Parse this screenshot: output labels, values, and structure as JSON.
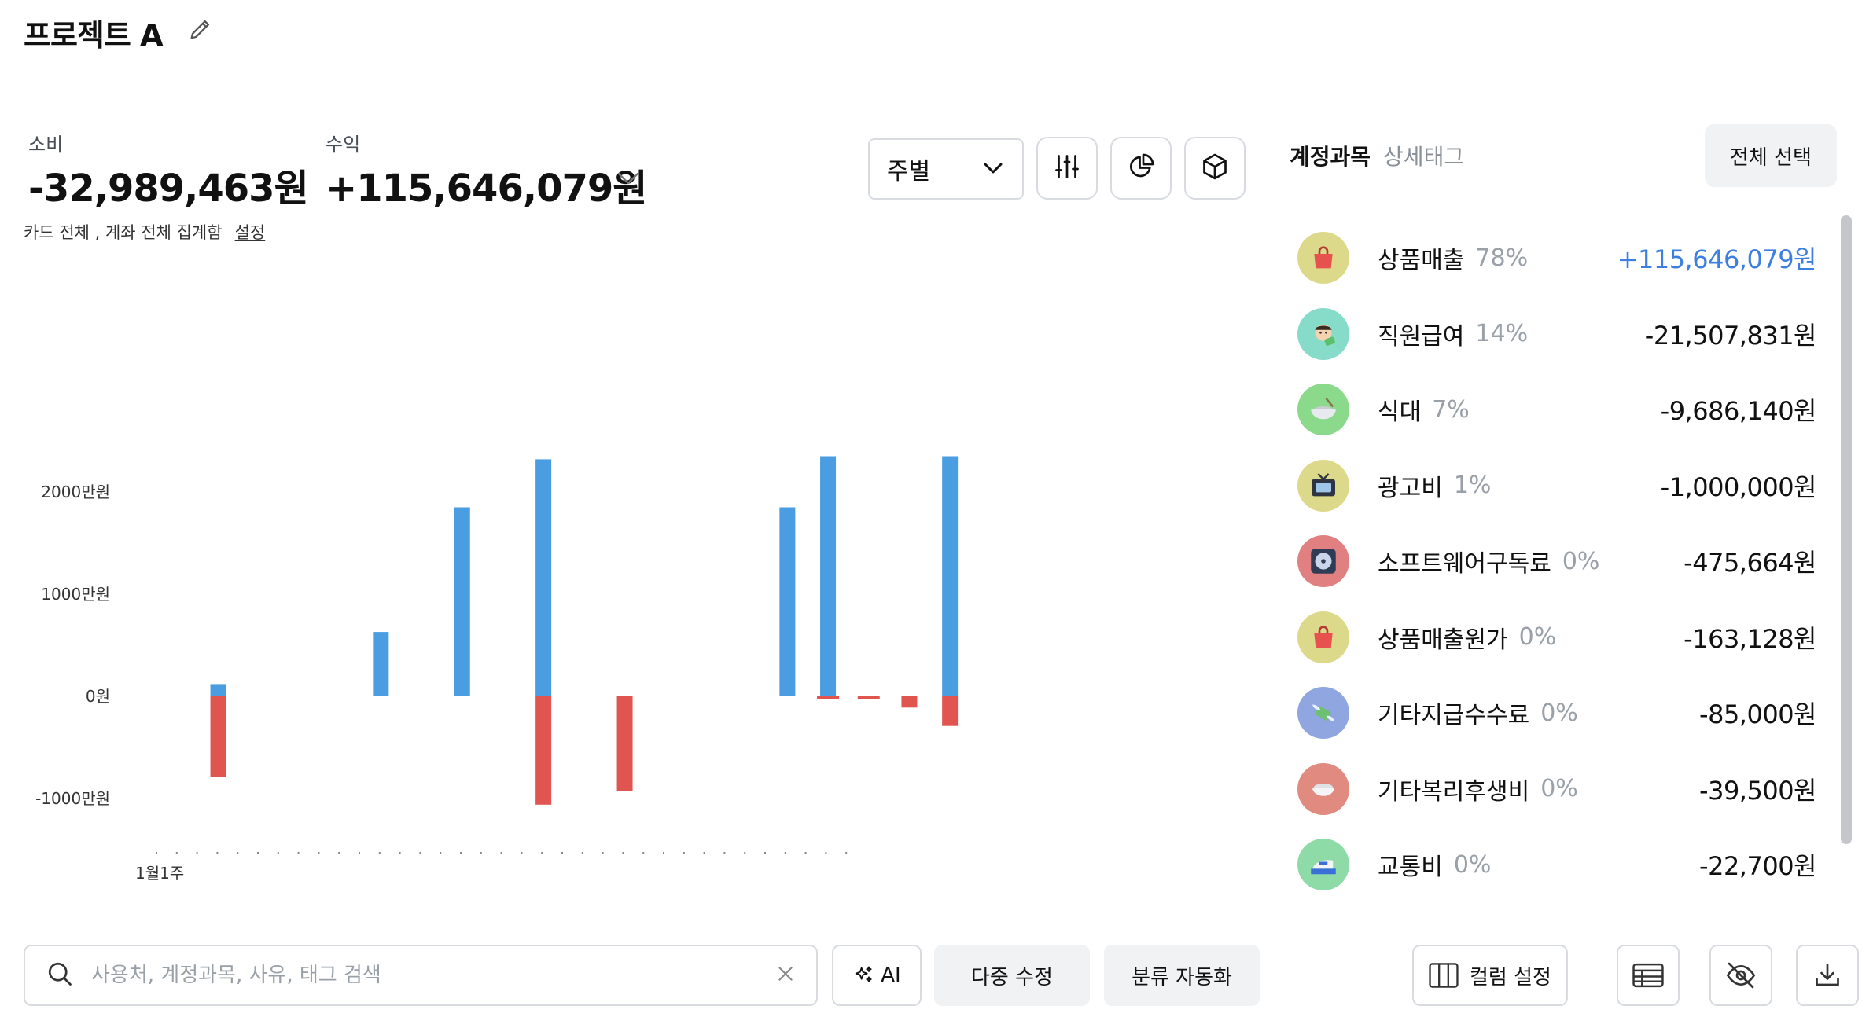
{
  "header": {
    "title": "프로젝트 A"
  },
  "summary": {
    "expense_label": "소비",
    "expense_value": "-32,989,463원",
    "income_label": "수익",
    "income_value": "+115,646,079원",
    "agg_note": "카드 전체 , 계좌 전체 집계함",
    "agg_link": "설정"
  },
  "controls": {
    "period_value": "주별"
  },
  "chart_data": {
    "type": "bar",
    "x_start_label": "1월1주",
    "y_tick_labels": [
      "2000만원",
      "1000만원",
      "0원",
      "-1000만원"
    ],
    "y_ticks": [
      20000000,
      10000000,
      0,
      -10000000
    ],
    "ylim": [
      -10500000,
      23500000
    ],
    "slots": 26,
    "series": [
      {
        "color": "#4a9de0",
        "values": [
          1200000,
          0,
          6300000,
          18500000,
          23200000,
          0,
          0,
          18500000,
          23500000,
          0,
          0,
          23500000
        ]
      },
      {
        "color": "#e05550",
        "values": [
          -7900000,
          0,
          0,
          0,
          -10600000,
          -9300000,
          0,
          0,
          -150000,
          -150000,
          -1100000,
          -2900000
        ]
      }
    ],
    "bar_positions": [
      1,
      3,
      5,
      7,
      9,
      11,
      13,
      15,
      16,
      17,
      18,
      19
    ],
    "dashed_indices": [
      8,
      9
    ]
  },
  "panel": {
    "tab_active": "계정과목",
    "tab_inactive": "상세태그",
    "select_all": "전체 선택",
    "categories": [
      {
        "name": "상품매출",
        "pct": "78%",
        "amount": "+115,646,079원",
        "positive": true,
        "icon": "shopping-bag-icon",
        "bg": "#ddd98a"
      },
      {
        "name": "직원급여",
        "pct": "14%",
        "amount": "-21,507,831원",
        "positive": false,
        "icon": "employee-icon",
        "bg": "#86dcc8"
      },
      {
        "name": "식대",
        "pct": "7%",
        "amount": "-9,686,140원",
        "positive": false,
        "icon": "bowl-icon",
        "bg": "#8bd98a"
      },
      {
        "name": "광고비",
        "pct": "1%",
        "amount": "-1,000,000원",
        "positive": false,
        "icon": "tv-icon",
        "bg": "#ddd98a"
      },
      {
        "name": "소프트웨어구독료",
        "pct": "0%",
        "amount": "-475,664원",
        "positive": false,
        "icon": "disc-icon",
        "bg": "#e08080"
      },
      {
        "name": "상품매출원가",
        "pct": "0%",
        "amount": "-163,128원",
        "positive": false,
        "icon": "shopping-bag-icon",
        "bg": "#ddd98a"
      },
      {
        "name": "기타지급수수료",
        "pct": "0%",
        "amount": "-85,000원",
        "positive": false,
        "icon": "money-wings-icon",
        "bg": "#8fa6e0"
      },
      {
        "name": "기타복리후생비",
        "pct": "0%",
        "amount": "-39,500원",
        "positive": false,
        "icon": "rice-bowl-icon",
        "bg": "#e08a80"
      },
      {
        "name": "교통비",
        "pct": "0%",
        "amount": "-22,700원",
        "positive": false,
        "icon": "train-icon",
        "bg": "#8edba8"
      }
    ]
  },
  "toolbar": {
    "search_placeholder": "사용처, 계정과목, 사유, 태그 검색",
    "ai_label": "AI",
    "bulk_edit_label": "다중 수정",
    "auto_classify_label": "분류 자동화",
    "column_settings_label": "컬럼 설정"
  }
}
